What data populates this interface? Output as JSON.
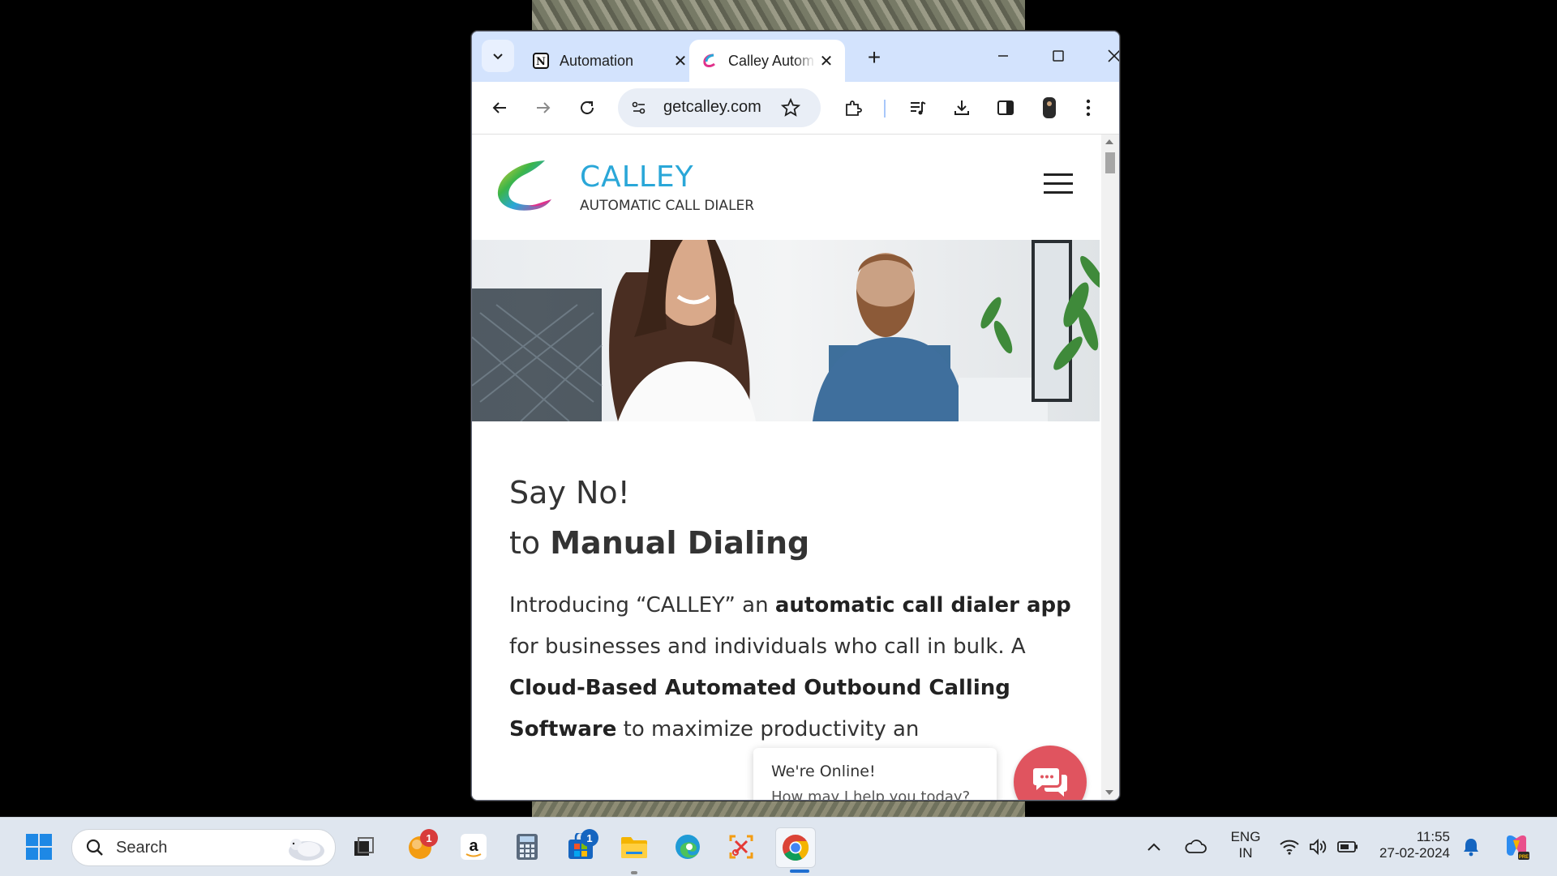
{
  "browser": {
    "tabs": [
      {
        "title": "Automation",
        "favicon": "notion-icon"
      },
      {
        "title": "Calley Autom",
        "favicon": "calley-icon",
        "active": true
      }
    ],
    "address": "getcalley.com"
  },
  "site": {
    "brand": "CALLEY",
    "tagline": "AUTOMATIC CALL DIALER",
    "headline1": "Say No!",
    "headline2_prefix": "to ",
    "headline2_bold": "Manual Dialing",
    "intro": {
      "p1": "Introducing “CALLEY” an ",
      "b1": "automatic call dialer app",
      "p2": " for businesses and individuals who call in bulk. A ",
      "b2": "Cloud-Based Automated Outbound Calling Software",
      "p3": " to maximize productivity an"
    },
    "chat": {
      "line1": "We're Online!",
      "line2": "How may I help you today?"
    }
  },
  "taskbar": {
    "search_label": "Search",
    "badges": {
      "app_orange": "1",
      "store": "1"
    },
    "lang1": "ENG",
    "lang2": "IN",
    "time": "11:55",
    "date": "27-02-2024"
  }
}
